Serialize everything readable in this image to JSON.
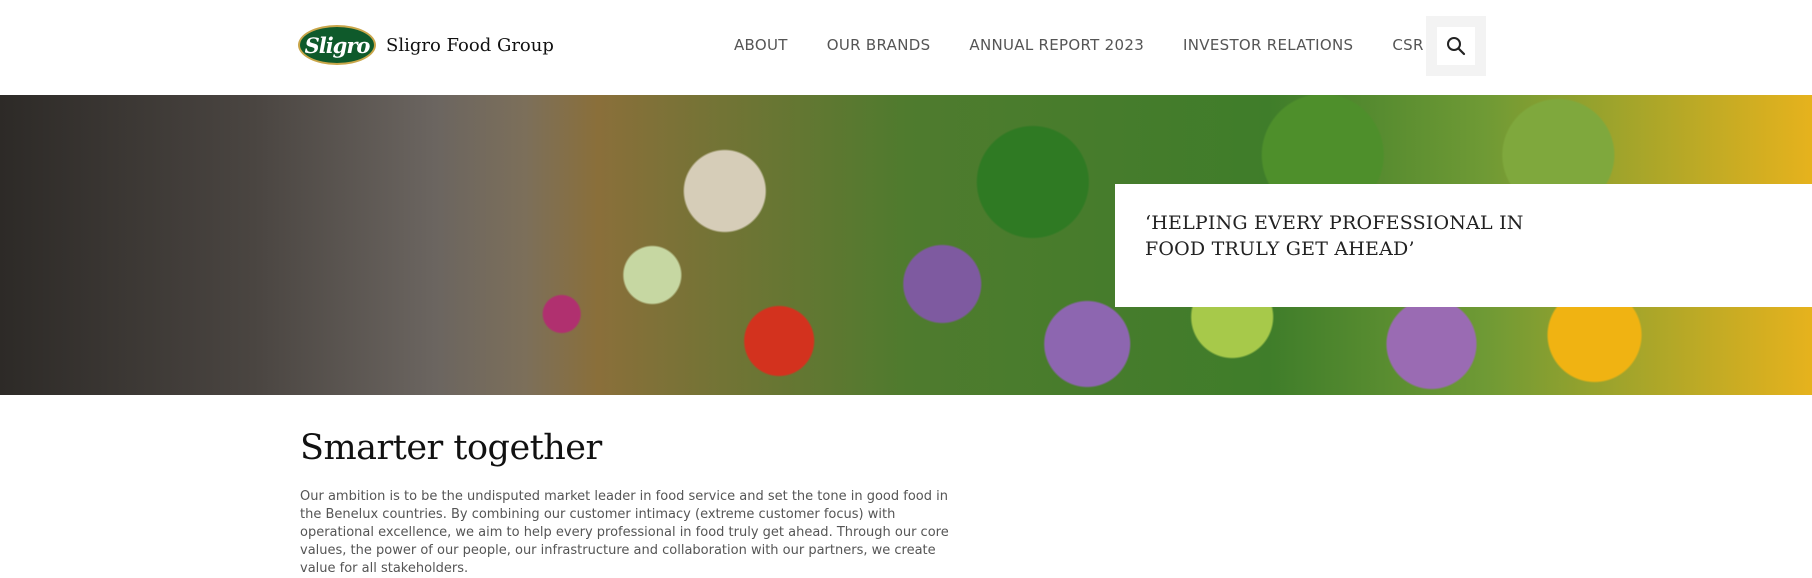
{
  "header": {
    "logo_text": "Sligro",
    "company_name": "Sligro Food Group",
    "nav": [
      "ABOUT",
      "OUR BRANDS",
      "ANNUAL REPORT 2023",
      "INVESTOR RELATIONS",
      "CSR"
    ],
    "search_icon": "search-icon"
  },
  "hero": {
    "quote": "‘HELPING EVERY PROFESSIONAL IN FOOD TRULY GET AHEAD’"
  },
  "main": {
    "title": "Smarter together",
    "body": "Our ambition is to be the undisputed market leader in food service and set the tone in good food in the Benelux countries. By combining our customer intimacy (extreme customer focus) with operational excellence, we aim to help every professional in food truly get ahead. Through our core values, the power of our people, our infrastructure and collaboration with our partners, we create value for all stakeholders."
  },
  "colors": {
    "brand_green": "#0f5a2b",
    "brand_gold": "#c9a64a"
  }
}
